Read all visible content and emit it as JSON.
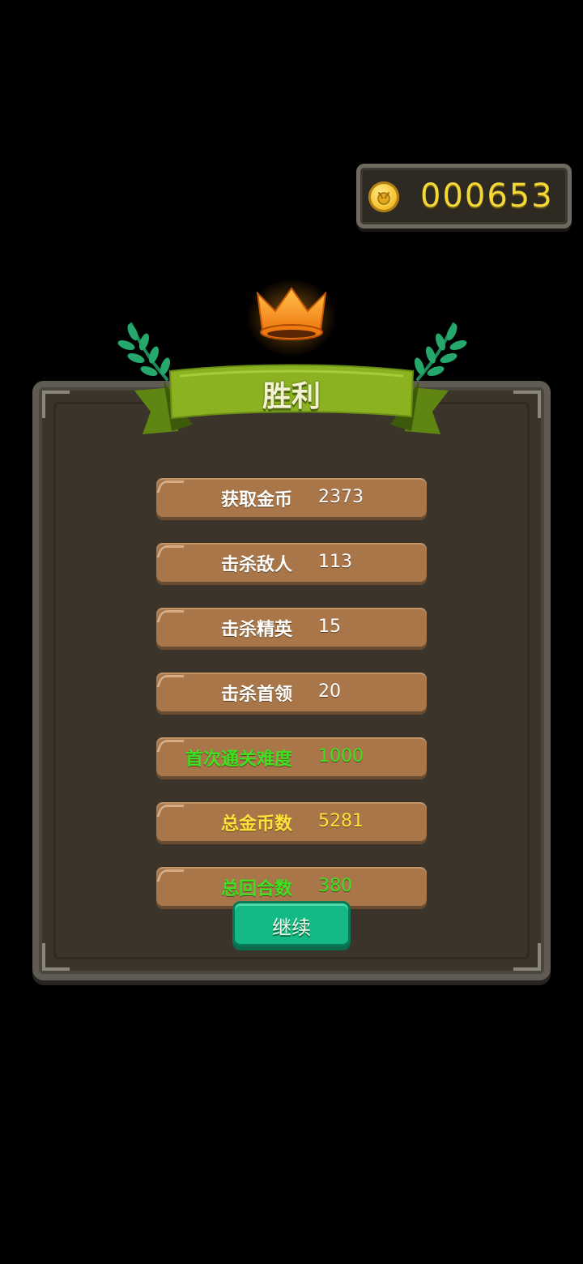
{
  "coins": {
    "value": "000653",
    "icon": "coin-icon"
  },
  "header": {
    "title": "胜利",
    "crown_icon": "crown-icon",
    "laurel_icon": "laurel-icon"
  },
  "stats": [
    {
      "label": "获取金币",
      "value": "2373",
      "color": "#ffffff"
    },
    {
      "label": "击杀敌人",
      "value": "113",
      "color": "#ffffff"
    },
    {
      "label": "击杀精英",
      "value": "15",
      "color": "#ffffff"
    },
    {
      "label": "击杀首领",
      "value": "20",
      "color": "#ffffff"
    },
    {
      "label": "首次通关难度",
      "value": "1000",
      "color": "#3fe020"
    },
    {
      "label": "总金币数",
      "value": "5281",
      "color": "#ffe23a"
    },
    {
      "label": "总回合数",
      "value": "380",
      "color": "#3fe020"
    }
  ],
  "actions": {
    "continue_label": "继续"
  },
  "colors": {
    "background": "#000000",
    "panel": "#3a342b",
    "row": "#a87649",
    "ribbon": "#8bb321",
    "button": "#15b985",
    "coin_text": "#f5d73a"
  }
}
